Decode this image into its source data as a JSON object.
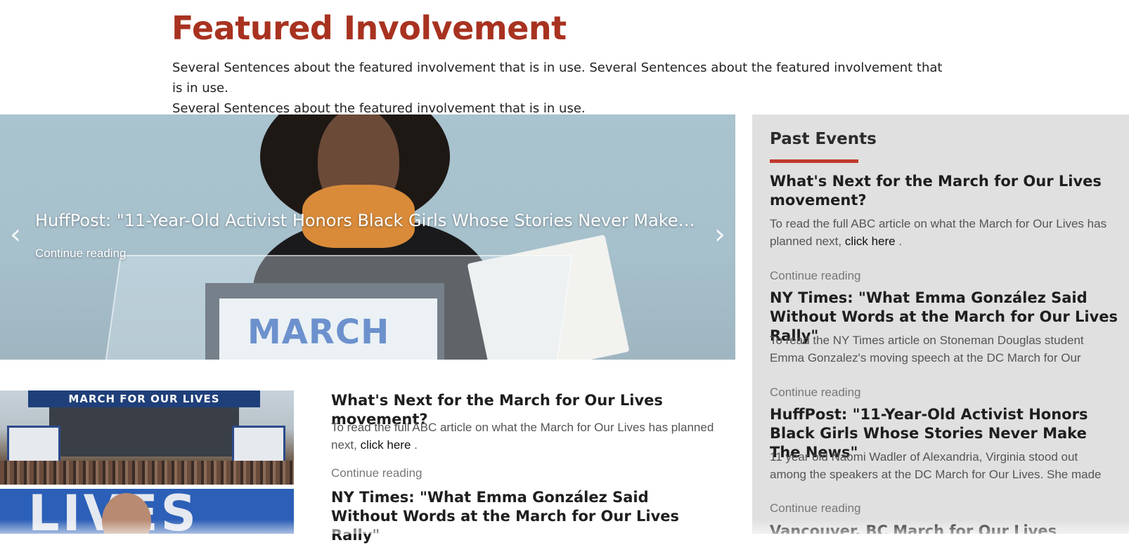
{
  "page": {
    "title": "Featured Involvement",
    "intro_line1": "Several Sentences about the featured involvement that is in use. Several Sentences about the featured involvement that is in use.",
    "intro_line2": "Several Sentences about the featured involvement that is in use."
  },
  "carousel": {
    "caption": "HuffPost: \"11-Year-Old Activist Honors Black Girls Whose Stories Never Make T...",
    "link": "Continue reading",
    "prev_icon": "‹",
    "next_icon": "›",
    "image_text": "MARCH"
  },
  "posts": [
    {
      "thumb_text": "MARCH FOR OUR LIVES",
      "title": "What's Next for the March for Our Lives movement?",
      "excerpt_before": "To read the full ABC article on what the March for Our Lives has planned next,",
      "excerpt_link": "click here",
      "excerpt_after": ".",
      "continue": "Continue reading"
    },
    {
      "thumb_text": "LIVES",
      "title": "NY Times: \"What Emma González Said Without Words at the March for Our Lives Rally\""
    }
  ],
  "sidebar": {
    "heading": "Past Events",
    "items": [
      {
        "title": "What's Next for the March for Our Lives movement?",
        "excerpt_before": "To read the full ABC article on what the March for Our Lives has planned next,",
        "excerpt_link": "click here",
        "excerpt_after": ".",
        "continue": "Continue reading"
      },
      {
        "title": "NY Times: \"What Emma González Said Without Words at the March for Our Lives Rally\"",
        "excerpt_line1": "To read the NY Times article on Stoneman Douglas student",
        "excerpt_line2": "Emma Gonzalez's moving speech at the DC March for Our",
        "continue": "Continue reading"
      },
      {
        "title": "HuffPost: \"11-Year-Old Activist Honors Black Girls Whose Stories Never Make The News\"",
        "excerpt_line1": "11 year old Naomi Wadler of Alexandria, Virginia stood out",
        "excerpt_line2": "among the speakers at the DC March for Our Lives.  She made",
        "continue": "Continue reading"
      },
      {
        "title": "Vancouver, BC March for Our Lives"
      }
    ]
  },
  "colors": {
    "accent": "#a83220",
    "rule": "#c0392b",
    "sidebar_bg": "#e0e0e0"
  }
}
